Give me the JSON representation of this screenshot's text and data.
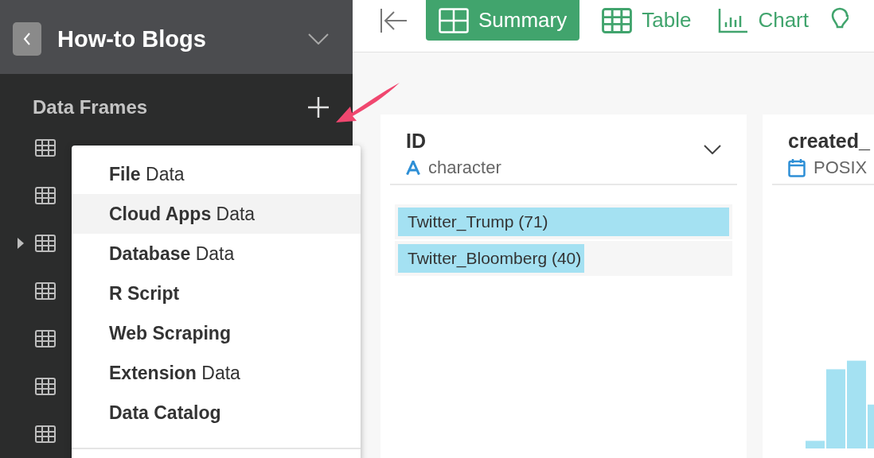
{
  "sidebar": {
    "project_title": "How-to Blogs",
    "section_title": "Data Frames",
    "items": [
      {
        "expandable": false
      },
      {
        "expandable": false
      },
      {
        "expandable": true
      },
      {
        "expandable": false
      },
      {
        "expandable": false
      },
      {
        "expandable": false
      },
      {
        "expandable": false
      }
    ]
  },
  "add_menu": {
    "items": [
      {
        "label": "**File** Data",
        "selected": false
      },
      {
        "label": "**Cloud Apps** Data",
        "selected": true
      },
      {
        "label": "**Database** Data",
        "selected": false
      },
      {
        "label": "**R Script**",
        "selected": false
      },
      {
        "label": "**Web Scraping**",
        "selected": false
      },
      {
        "label": "**Extension** Data",
        "selected": false
      },
      {
        "label": "**Data Catalog**",
        "selected": false
      }
    ]
  },
  "toolbar": {
    "tabs": [
      {
        "label": "Summary",
        "kind": "summary",
        "selected": true
      },
      {
        "label": "Table",
        "kind": "table",
        "selected": false
      },
      {
        "label": "Chart",
        "kind": "chart",
        "selected": false
      }
    ]
  },
  "columns": [
    {
      "name": "ID",
      "type": "character",
      "kind": "text",
      "values": [
        {
          "label": "Twitter_Trump (71)",
          "level": 1.0
        },
        {
          "label": "Twitter_Bloomberg (40)",
          "level": 0.563
        }
      ]
    },
    {
      "name": "created_",
      "type": "POSIX",
      "kind": "date"
    }
  ]
}
